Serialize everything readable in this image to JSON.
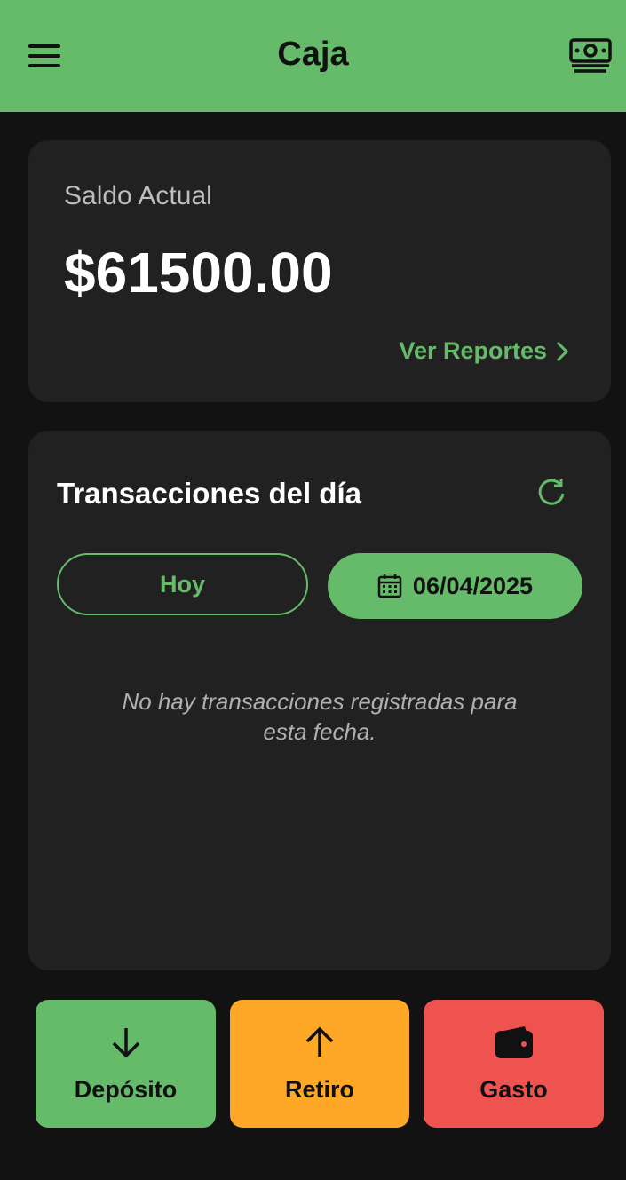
{
  "appbar": {
    "title": "Caja",
    "menu_icon": "menu-icon",
    "right_icon": "cash-icon"
  },
  "balance": {
    "label": "Saldo Actual",
    "value": "$61500.00",
    "reports_link": "Ver Reportes"
  },
  "transactions": {
    "title": "Transacciones del día",
    "today_button": "Hoy",
    "date_button": "06/04/2025",
    "empty_message": "No hay transacciones registradas para esta fecha."
  },
  "actions": [
    {
      "label": "Depósito",
      "icon": "arrow-down-icon",
      "color": "#66bb6a"
    },
    {
      "label": "Retiro",
      "icon": "arrow-up-icon",
      "color": "#ffa726"
    },
    {
      "label": "Gasto",
      "icon": "wallet-icon",
      "color": "#ef5350"
    }
  ],
  "colors": {
    "accent": "#66bb6a",
    "background": "#121212",
    "card": "#212121"
  }
}
